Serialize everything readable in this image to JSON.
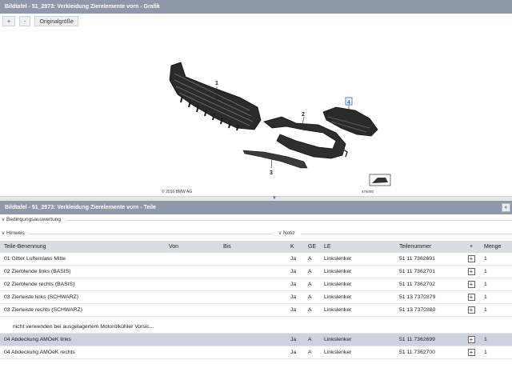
{
  "graphic_panel": {
    "title": "Bildtafel - 51_2973: Verkleidung Zierelemente vorn - Grafik",
    "zoom_in": "+",
    "zoom_out": "-",
    "original_size": "Originalgröße",
    "copyright": "© 2016 BMW AG",
    "diagram_code": "476080",
    "callouts": [
      "1",
      "2",
      "3",
      "4"
    ],
    "highlight_color": "#1f5fbf"
  },
  "parts_panel": {
    "title": "Bildtafel - 51_2973: Verkleidung Zierelemente vorn - Teile",
    "collapse_icon": "«",
    "sections": {
      "conditions": "Bedingungsauswertung",
      "hint": "Hinweis",
      "note": "Notiz"
    },
    "columns": [
      "Teile-Benennung",
      "Von",
      "Bis",
      "K",
      "GE",
      "LE",
      "Teilenummer",
      "+",
      "Menge"
    ],
    "rows": [
      {
        "name": "01 Gitter Lufteinlass Mitte",
        "von": "",
        "bis": "",
        "k": "Ja",
        "ge": "A",
        "le": "Linkslenker",
        "nr": "51 11 7362691",
        "menge": "1"
      },
      {
        "name": "02 Zierblende links (BASIS)",
        "von": "",
        "bis": "",
        "k": "Ja",
        "ge": "A",
        "le": "Linkslenker",
        "nr": "51 11 7362701",
        "menge": "1"
      },
      {
        "name": "02 Zierblende rechts (BASIS)",
        "von": "",
        "bis": "",
        "k": "Ja",
        "ge": "A",
        "le": "Linkslenker",
        "nr": "51 11 7362702",
        "menge": "1"
      },
      {
        "name": "03 Zierleiste links (SCHWARZ)",
        "von": "",
        "bis": "",
        "k": "Ja",
        "ge": "A",
        "le": "Linkslenker",
        "nr": "51 13 7370379",
        "menge": "1"
      },
      {
        "name": "03 Zierleiste rechts (SCHWARZ)",
        "von": "",
        "bis": "",
        "k": "Ja",
        "ge": "A",
        "le": "Linkslenker",
        "nr": "51 13 7370380",
        "menge": "1"
      }
    ],
    "note_row": "nicht verwenden bei ausgelagertem Motorölkühler Vorsic...",
    "rows2": [
      {
        "name": "04 Abdeckung AMOeK links",
        "von": "",
        "bis": "",
        "k": "Ja",
        "ge": "A",
        "le": "Linkslenker",
        "nr": "51 11 7362699",
        "menge": "1"
      },
      {
        "name": "04 Abdeckung AMOeK rechts",
        "von": "",
        "bis": "",
        "k": "Ja",
        "ge": "A",
        "le": "Linkslenker",
        "nr": "51 11 7362700",
        "menge": "1"
      }
    ]
  }
}
